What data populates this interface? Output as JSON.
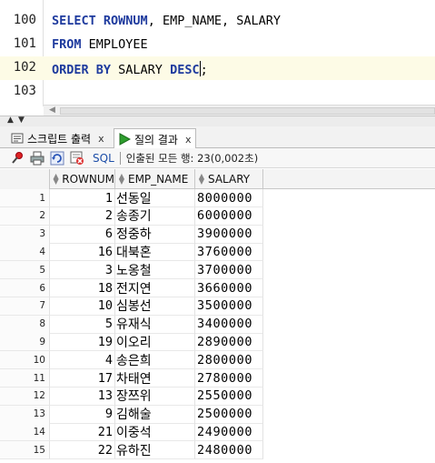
{
  "editor": {
    "lines": [
      {
        "number": "100",
        "tokens": [
          {
            "text": "SELECT",
            "kw": true
          },
          {
            "text": " ",
            "kw": true
          },
          {
            "text": "ROWNUM",
            "kw": true
          },
          {
            "text": ", EMP_NAME, SALARY",
            "kw": false
          }
        ]
      },
      {
        "number": "101",
        "tokens": [
          {
            "text": "FROM",
            "kw": true
          },
          {
            "text": " EMPLOYEE",
            "kw": false
          }
        ]
      },
      {
        "number": "102",
        "tokens": [
          {
            "text": "ORDER BY",
            "kw": true
          },
          {
            "text": " SALARY ",
            "kw": false
          },
          {
            "text": "DESC",
            "kw": true
          },
          {
            "text": ";",
            "kw": false
          }
        ]
      },
      {
        "number": "103",
        "tokens": []
      }
    ],
    "current_line": 2
  },
  "tabs": [
    {
      "label": "스크립트 출력",
      "icon": "script-output-icon",
      "active": false,
      "close": "x"
    },
    {
      "label": "질의 결과",
      "icon": "run-query-icon",
      "active": true,
      "close": "x"
    }
  ],
  "toolbar": {
    "sql_label": "SQL",
    "status": "인출된 모든 행: 23(0,002초)",
    "icons": [
      "pin-icon",
      "print-icon",
      "refresh-icon",
      "cancel-fetch-icon"
    ]
  },
  "grid": {
    "columns": [
      "ROWNUM",
      "EMP_NAME",
      "SALARY"
    ],
    "rows": [
      {
        "idx": "1",
        "rownum": "1",
        "name": "선동일",
        "salary": "8000000"
      },
      {
        "idx": "2",
        "rownum": "2",
        "name": "송종기",
        "salary": "6000000"
      },
      {
        "idx": "3",
        "rownum": "6",
        "name": "정중하",
        "salary": "3900000"
      },
      {
        "idx": "4",
        "rownum": "16",
        "name": "대북혼",
        "salary": "3760000"
      },
      {
        "idx": "5",
        "rownum": "3",
        "name": "노옹철",
        "salary": "3700000"
      },
      {
        "idx": "6",
        "rownum": "18",
        "name": "전지연",
        "salary": "3660000"
      },
      {
        "idx": "7",
        "rownum": "10",
        "name": "심봉선",
        "salary": "3500000"
      },
      {
        "idx": "8",
        "rownum": "5",
        "name": "유재식",
        "salary": "3400000"
      },
      {
        "idx": "9",
        "rownum": "19",
        "name": "이오리",
        "salary": "2890000"
      },
      {
        "idx": "10",
        "rownum": "4",
        "name": "송은희",
        "salary": "2800000"
      },
      {
        "idx": "11",
        "rownum": "17",
        "name": "차태연",
        "salary": "2780000"
      },
      {
        "idx": "12",
        "rownum": "13",
        "name": "장쯔위",
        "salary": "2550000"
      },
      {
        "idx": "13",
        "rownum": "9",
        "name": "김해술",
        "salary": "2500000"
      },
      {
        "idx": "14",
        "rownum": "21",
        "name": "이중석",
        "salary": "2490000"
      },
      {
        "idx": "15",
        "rownum": "22",
        "name": "유하진",
        "salary": "2480000"
      }
    ]
  },
  "colors": {
    "keyword": "#1f3b9e",
    "sql_link": "#1d4ea8",
    "current_line": "#fdfbe6"
  }
}
